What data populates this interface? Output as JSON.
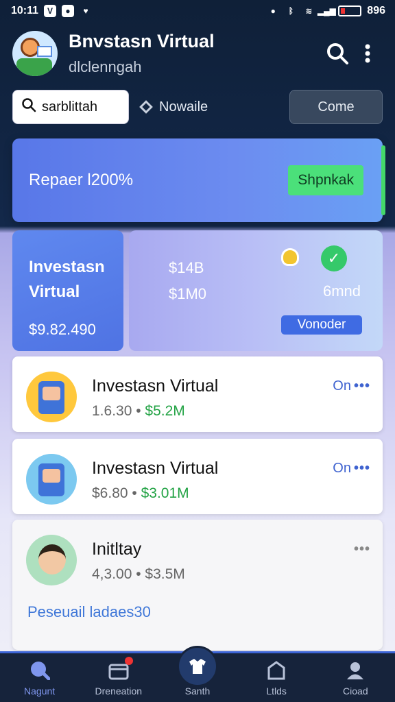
{
  "status_bar": {
    "time": "10:11",
    "battery_label": "896"
  },
  "header": {
    "title": "Bnvstasn Virtual",
    "subtitle": "dlclenngah",
    "search_icon": "search-icon",
    "menu_icon": "more-vert-icon"
  },
  "controls": {
    "search_value": "sarblittah",
    "chip_label": "Nowaile",
    "button_label": "Come"
  },
  "banner": {
    "text": "Repaer l200%",
    "button_label": "Shpnkak",
    "accent_color": "#4be07a"
  },
  "tiles": {
    "left": {
      "title_line1": "Investasn",
      "title_line2": "Virtual",
      "value": "$9.82.490"
    },
    "right": {
      "value1": "$14B",
      "value2": "$1M0",
      "side_label": "6mnd",
      "button_label": "Vonoder"
    }
  },
  "list": [
    {
      "title": "Investasn Virtual",
      "meta_qty": "1.6.30",
      "meta_price": "$5.2M",
      "action": "On"
    },
    {
      "title": "Investasn Virtual",
      "meta_qty": "$6.80",
      "meta_price": "$3.01M",
      "action": "On"
    },
    {
      "title": "Initltay",
      "meta_qty": "4,3.00",
      "meta_price": "$3.5M",
      "action": "",
      "link": "Peseuail ladaes30"
    }
  ],
  "bottom_nav": [
    {
      "label": "Nagunt",
      "icon": "home-icon"
    },
    {
      "label": "Dreneation",
      "icon": "calendar-icon"
    },
    {
      "label": "Santh",
      "icon": "shirt-icon"
    },
    {
      "label": "Ltlds",
      "icon": "shop-icon"
    },
    {
      "label": "Cioad",
      "icon": "profile-icon"
    }
  ]
}
